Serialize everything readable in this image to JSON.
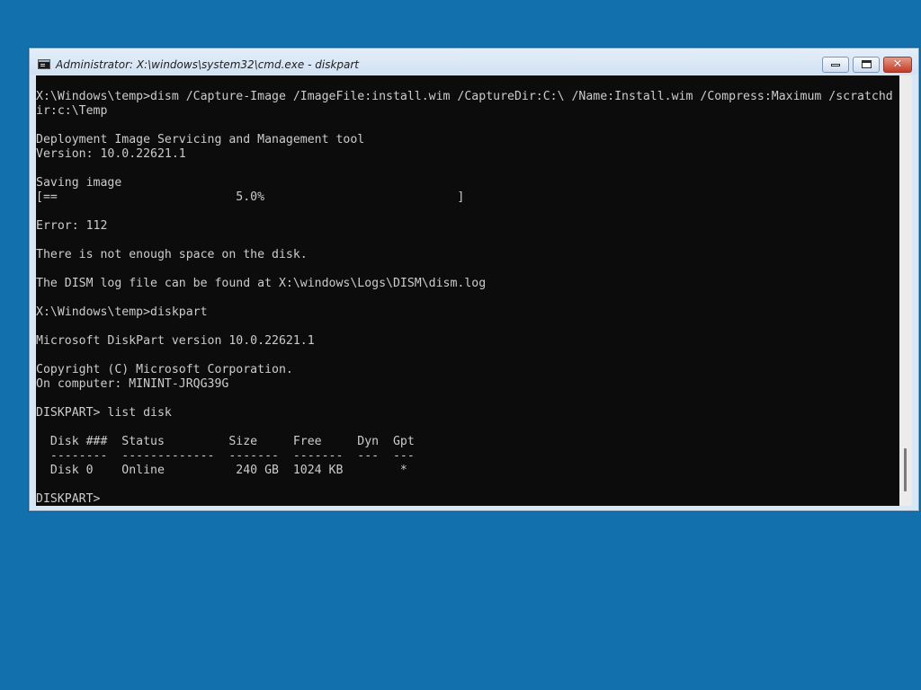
{
  "window": {
    "title": "Administrator: X:\\windows\\system32\\cmd.exe - diskpart",
    "icon": "cmd-icon",
    "buttons": {
      "minimize": "minimize-icon",
      "maximize": "maximize-icon",
      "close_label": "✕"
    }
  },
  "console": {
    "lines": [
      "X:\\Windows\\temp>dism /Capture-Image /ImageFile:install.wim /CaptureDir:C:\\ /Name:Install.wim /Compress:Maximum /scratchd",
      "ir:c:\\Temp",
      "",
      "Deployment Image Servicing and Management tool",
      "Version: 10.0.22621.1",
      "",
      "Saving image",
      "[==                         5.0%                           ]",
      "",
      "Error: 112",
      "",
      "There is not enough space on the disk.",
      "",
      "The DISM log file can be found at X:\\windows\\Logs\\DISM\\dism.log",
      "",
      "X:\\Windows\\temp>diskpart",
      "",
      "Microsoft DiskPart version 10.0.22621.1",
      "",
      "Copyright (C) Microsoft Corporation.",
      "On computer: MININT-JRQG39G",
      "",
      "DISKPART> list disk",
      "",
      "  Disk ###  Status         Size     Free     Dyn  Gpt",
      "  --------  -------------  -------  -------  ---  ---",
      "  Disk 0    Online          240 GB  1024 KB        *",
      "",
      "DISKPART> "
    ]
  },
  "colors": {
    "desktop": "#1270ad",
    "console_bg": "#0c0c0c",
    "console_fg": "#cccccc"
  }
}
